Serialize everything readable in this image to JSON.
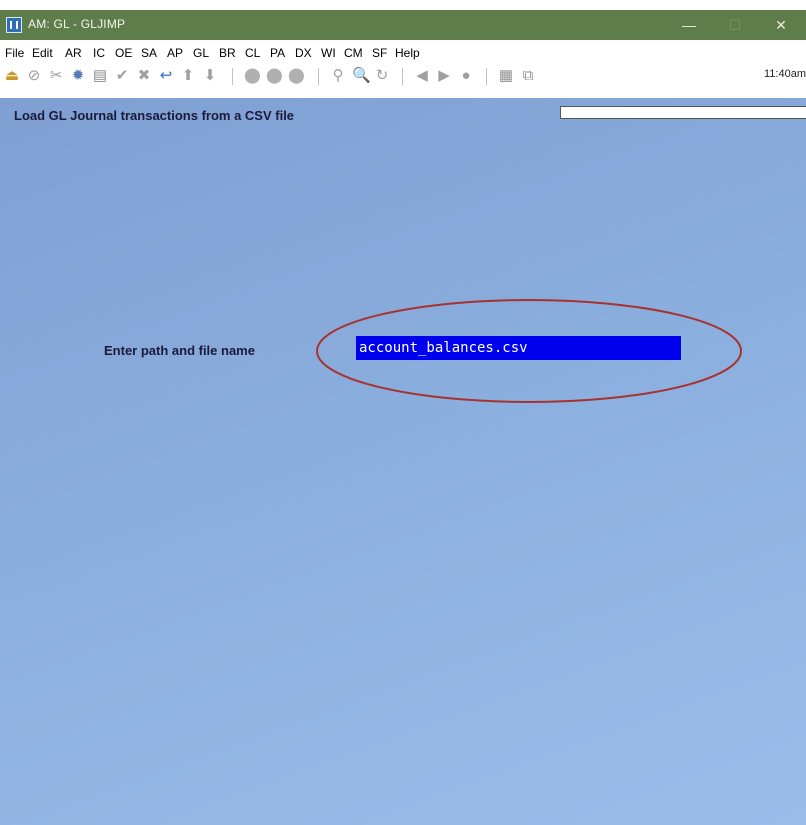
{
  "window": {
    "title": "AM: GL - GLJIMP",
    "minimize_glyph": "—",
    "maximize_glyph": "☐",
    "close_glyph": "✕"
  },
  "menu": [
    "File",
    "Edit",
    "AR",
    "IC",
    "OE",
    "SA",
    "AP",
    "GL",
    "BR",
    "CL",
    "PA",
    "DX",
    "WI",
    "CM",
    "SF",
    "Help"
  ],
  "toolbar": {
    "icons": [
      {
        "name": "exit-icon",
        "glyph": "⏏",
        "color": "#c79a28"
      },
      {
        "name": "cancel-icon",
        "glyph": "⊘",
        "color": "#9a9a9a"
      },
      {
        "name": "tools-icon",
        "glyph": "✂",
        "color": "#9a9a9a"
      },
      {
        "name": "settings-icon",
        "glyph": "✹",
        "color": "#5878b8"
      },
      {
        "name": "print-icon",
        "glyph": "▤",
        "color": "#8a8a8a"
      },
      {
        "name": "check-icon",
        "glyph": "✔",
        "color": "#a0a0a0"
      },
      {
        "name": "delete-icon",
        "glyph": "✖",
        "color": "#a0a0a0"
      },
      {
        "name": "undo-icon",
        "glyph": "↩",
        "color": "#2f6fd0"
      },
      {
        "name": "arrow-up-icon",
        "glyph": "⬆",
        "color": "#a0a0a0"
      },
      {
        "name": "arrow-down-icon",
        "glyph": "⬇",
        "color": "#a0a0a0"
      },
      {
        "name": "circle-1-icon",
        "glyph": "⬤",
        "color": "#b0b0b0"
      },
      {
        "name": "circle-2-icon",
        "glyph": "⬤",
        "color": "#b0b0b0"
      },
      {
        "name": "circle-3-icon",
        "glyph": "⬤",
        "color": "#b0b0b0"
      },
      {
        "name": "binoculars-icon",
        "glyph": "⚲",
        "color": "#a0a0a0"
      },
      {
        "name": "zoom-icon",
        "glyph": "🔍",
        "color": "#a0a0a0"
      },
      {
        "name": "refresh-icon",
        "glyph": "↻",
        "color": "#a0a0a0"
      },
      {
        "name": "previous-icon",
        "glyph": "◀",
        "color": "#a0a0a0"
      },
      {
        "name": "next-icon",
        "glyph": "▶",
        "color": "#a0a0a0"
      },
      {
        "name": "stop-icon",
        "glyph": "●",
        "color": "#a0a0a0"
      },
      {
        "name": "calculator-icon",
        "glyph": "▦",
        "color": "#909090"
      },
      {
        "name": "copy-icon",
        "glyph": "⧉",
        "color": "#909090"
      }
    ],
    "clock": "11:40am"
  },
  "screen": {
    "header": "Load GL Journal transactions from a CSV file",
    "prompt_label": "Enter path and file name",
    "path_value": "account_balances.csv"
  }
}
